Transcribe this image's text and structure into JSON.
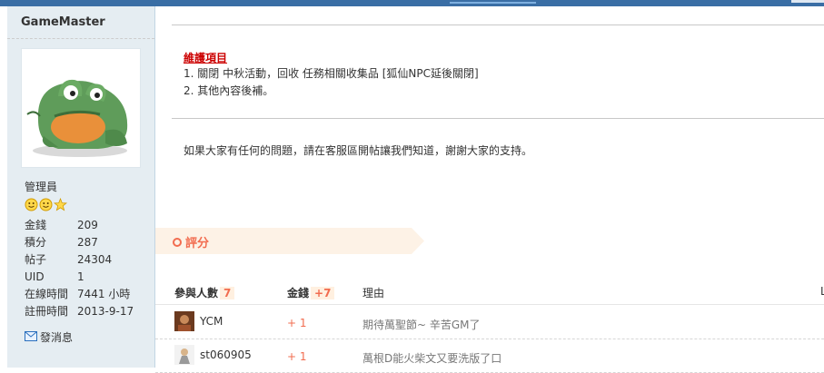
{
  "author": {
    "name": "GameMaster",
    "group": "管理員",
    "stars": [
      "smiley",
      "smiley",
      "star"
    ],
    "stats": [
      {
        "label": "金錢",
        "value": "209"
      },
      {
        "label": "積分",
        "value": "287"
      },
      {
        "label": "帖子",
        "value": "24304"
      },
      {
        "label": "UID",
        "value": "1"
      },
      {
        "label": "在線時間",
        "value": "7441 小時"
      },
      {
        "label": "註冊時間",
        "value": "2013-9-17"
      }
    ],
    "pm_label": "發消息"
  },
  "post": {
    "notice_title": "維護項目",
    "notice_lines": [
      "1. 關閉 中秋活動，回收 任務相關收集品 [狐仙NPC延後關閉]",
      "2. 其他內容後補。"
    ],
    "closing": "如果大家有任何的問題，請在客服區開帖讓我們知道，謝謝大家的支持。"
  },
  "rating": {
    "title": "評分",
    "participants_label": "參與人數",
    "participants_count": "7",
    "money_label": "金錢",
    "money_total": "+7",
    "reason_label": "理由",
    "far_label": "L",
    "rows": [
      {
        "user": "YCM",
        "amount": "+ 1",
        "reason": "期待萬聖節~ 辛苦GM了"
      },
      {
        "user": "st060905",
        "amount": "+ 1",
        "reason": "萬根D能火柴文又要洗版了口"
      }
    ]
  },
  "colors": {
    "accent": "#f26c4f",
    "notice": "#cc0000",
    "sidebar_bg": "#e5edf2",
    "topbar": "#3a6ea5"
  },
  "icons": {
    "rating": "ring-icon",
    "pm": "envelope-icon"
  }
}
